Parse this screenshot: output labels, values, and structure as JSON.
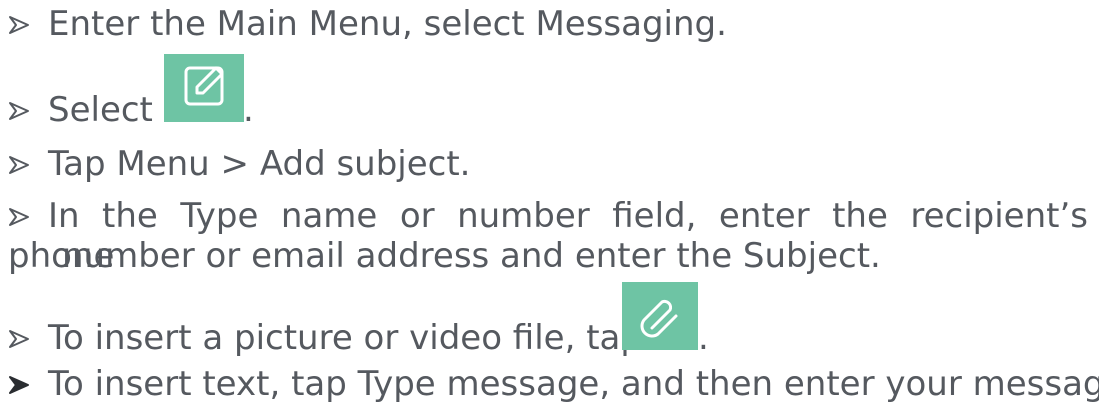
{
  "steps": [
    {
      "text": "Enter the Main Menu, select Messaging."
    },
    {
      "text": "Select",
      "suffix": ".",
      "icon": "compose-icon"
    },
    {
      "text": "Tap Menu > Add subject."
    },
    {
      "text": "In the Type name or number field, enter the recipient’s phone",
      "continuation": "number or email address and enter the Subject."
    },
    {
      "text": "To insert a picture or video file, tap",
      "suffix": ".",
      "icon": "attach-paperclip-icon"
    },
    {
      "text": "To insert text, tap Type message, and then enter your message."
    }
  ],
  "colors": {
    "text": "#55595f",
    "icon_tile": "#6ec4a4",
    "icon_glyph": "#ffffff",
    "bullet_arrow": "#55595f"
  },
  "icons": {
    "bullet": "arrow-bullet-icon",
    "step2": "compose-icon",
    "step5": "attach-paperclip-icon"
  }
}
